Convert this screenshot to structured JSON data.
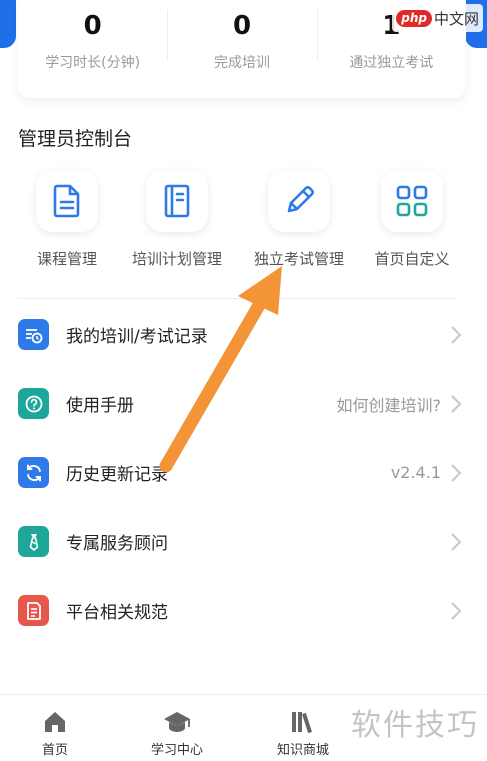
{
  "stats": [
    {
      "value": "0",
      "label": "学习时长(分钟)"
    },
    {
      "value": "0",
      "label": "完成培训"
    },
    {
      "value": "1",
      "label": "通过独立考试"
    }
  ],
  "admin_section": {
    "title": "管理员控制台"
  },
  "quick_actions": [
    {
      "label": "课程管理",
      "icon": "document-icon"
    },
    {
      "label": "培训计划管理",
      "icon": "notebook-icon"
    },
    {
      "label": "独立考试管理",
      "icon": "pencil-icon"
    },
    {
      "label": "首页自定义",
      "icon": "grid-icon"
    }
  ],
  "menu": [
    {
      "label": "我的培训/考试记录",
      "value": "",
      "icon": "record-icon",
      "color": "#2d7ae8"
    },
    {
      "label": "使用手册",
      "value": "如何创建培训?",
      "icon": "help-icon",
      "color": "#1ca79a"
    },
    {
      "label": "历史更新记录",
      "value": "v2.4.1",
      "icon": "refresh-icon",
      "color": "#2d7ae8"
    },
    {
      "label": "专属服务顾问",
      "value": "",
      "icon": "tie-icon",
      "color": "#1ca79a"
    },
    {
      "label": "平台相关规范",
      "value": "",
      "icon": "doc-list-icon",
      "color": "#e8574c"
    }
  ],
  "tabs": [
    {
      "label": "首页",
      "icon": "home-icon"
    },
    {
      "label": "学习中心",
      "icon": "graduation-cap-icon"
    },
    {
      "label": "知识商城",
      "icon": "books-icon"
    }
  ],
  "watermark": {
    "badge": "php",
    "site": "中文网",
    "bottom": "软件技巧"
  },
  "colors": {
    "brand_blue": "#1e6fe8",
    "accent_teal": "#1ca79a",
    "accent_red": "#e8574c",
    "arrow_orange": "#f39536"
  }
}
